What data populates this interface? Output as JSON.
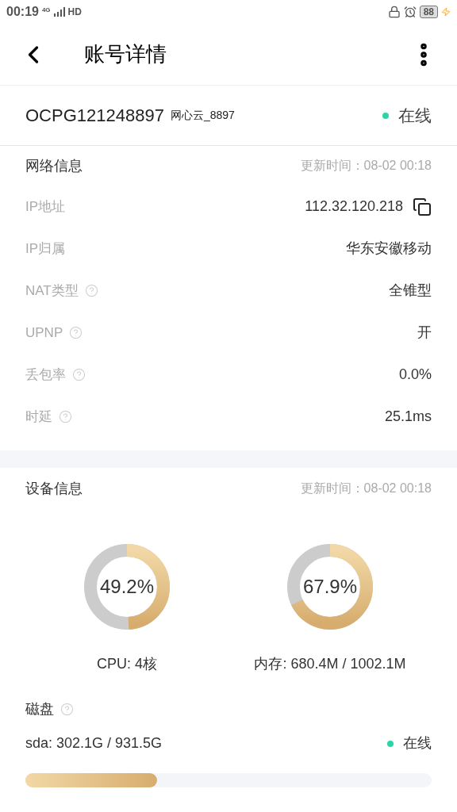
{
  "status_bar": {
    "time": "00:19",
    "network": "4G",
    "hd": "HD",
    "battery": "88"
  },
  "header": {
    "title": "账号详情"
  },
  "account": {
    "id": "OCPG121248897",
    "name": "网心云_8897",
    "status": "在线",
    "online": true
  },
  "network": {
    "title": "网络信息",
    "updated": "更新时间：08-02 00:18",
    "rows": [
      {
        "label": "IP地址",
        "value": "112.32.120.218",
        "help": false,
        "copyable": true
      },
      {
        "label": "IP归属",
        "value": "华东安徽移动",
        "help": false,
        "copyable": false
      },
      {
        "label": "NAT类型",
        "value": "全锥型",
        "help": true,
        "copyable": false
      },
      {
        "label": "UPNP",
        "value": "开",
        "help": true,
        "copyable": false
      },
      {
        "label": "丢包率",
        "value": "0.0%",
        "help": true,
        "copyable": false
      },
      {
        "label": "时延",
        "value": "25.1ms",
        "help": true,
        "copyable": false
      }
    ]
  },
  "device": {
    "title": "设备信息",
    "updated": "更新时间：08-02 00:18",
    "gauges": [
      {
        "reading": "49.2%",
        "caption": "CPU: 4核",
        "level": 0.492
      },
      {
        "reading": "67.9%",
        "caption": "内存: 680.4M / 1002.1M",
        "level": 0.679
      }
    ],
    "disk": {
      "title": "磁盘",
      "name": "sda: 302.1G / 931.5G",
      "status": "在线",
      "online": true,
      "level": 0.324
    }
  }
}
